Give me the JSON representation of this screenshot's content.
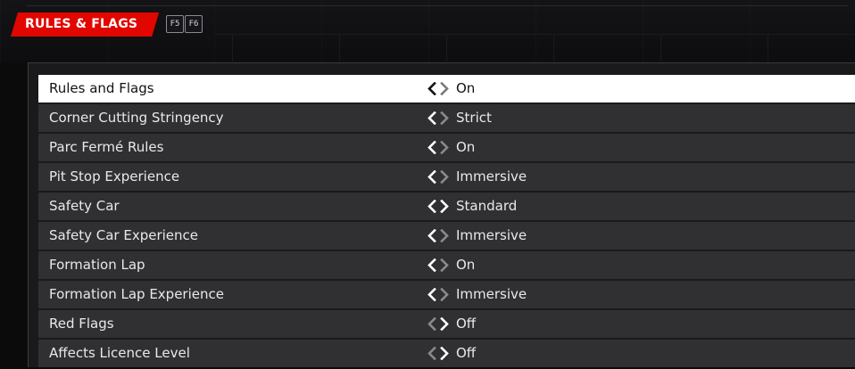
{
  "header": {
    "tab_title": "RULES & FLAGS",
    "key_left": "F5",
    "key_right": "F6"
  },
  "settings": [
    {
      "label": "Rules and Flags",
      "value": "On",
      "selected": true,
      "left_active": true,
      "right_active": false
    },
    {
      "label": "Corner Cutting Stringency",
      "value": "Strict",
      "selected": false,
      "left_active": true,
      "right_active": false
    },
    {
      "label": "Parc Fermé Rules",
      "value": "On",
      "selected": false,
      "left_active": true,
      "right_active": false
    },
    {
      "label": "Pit Stop Experience",
      "value": "Immersive",
      "selected": false,
      "left_active": true,
      "right_active": false
    },
    {
      "label": "Safety Car",
      "value": "Standard",
      "selected": false,
      "left_active": true,
      "right_active": true
    },
    {
      "label": "Safety Car Experience",
      "value": "Immersive",
      "selected": false,
      "left_active": true,
      "right_active": false
    },
    {
      "label": "Formation Lap",
      "value": "On",
      "selected": false,
      "left_active": true,
      "right_active": false
    },
    {
      "label": "Formation Lap Experience",
      "value": "Immersive",
      "selected": false,
      "left_active": true,
      "right_active": false
    },
    {
      "label": "Red Flags",
      "value": "Off",
      "selected": false,
      "left_active": false,
      "right_active": true
    },
    {
      "label": "Affects Licence Level",
      "value": "Off",
      "selected": false,
      "left_active": false,
      "right_active": true
    }
  ],
  "colors": {
    "accent": "#e10600",
    "row_bg": "#303033",
    "row_selected_bg": "#ffffff",
    "chevron_active_light": "#ffffff",
    "chevron_inactive_light": "#8a8a8e",
    "chevron_active_dark": "#111111",
    "chevron_inactive_dark": "#7a7a7e"
  }
}
